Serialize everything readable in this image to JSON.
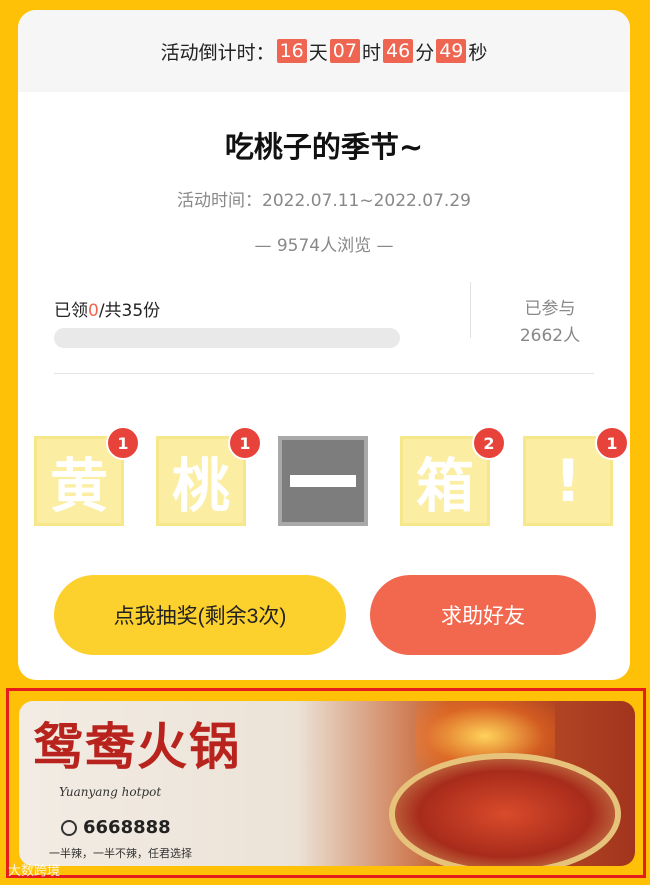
{
  "countdown": {
    "label": "活动倒计时：",
    "days": "16",
    "days_unit": "天",
    "hours": "07",
    "hours_unit": "时",
    "minutes": "46",
    "minutes_unit": "分",
    "seconds": "49",
    "seconds_unit": "秒"
  },
  "title": "吃桃子的季节~",
  "activity_time": "活动时间：2022.07.11~2022.07.29",
  "views": "— 9574人浏览 —",
  "stats": {
    "claimed_prefix": "已领",
    "claimed_count": "0",
    "claimed_suffix": "/共35份",
    "progress_fraction": 0,
    "joined_label": "已参与",
    "joined_count": "2662人"
  },
  "tiles": [
    {
      "char": "黄",
      "badge": "1"
    },
    {
      "char": "桃",
      "badge": "1"
    },
    {
      "char": "—",
      "badge": ""
    },
    {
      "char": "箱",
      "badge": "2"
    },
    {
      "char": "!",
      "badge": "1"
    }
  ],
  "buttons": {
    "draw_label": "点我抽奖(剩余3次)",
    "help_label": "求助好友"
  },
  "ad": {
    "name": "鸳鸯火锅",
    "subtitle": "Yuanyang hotpot",
    "phone": "6668888",
    "slogan": "一半辣，一半不辣，任君选择"
  },
  "watermark": "大数跨境",
  "colors": {
    "background": "#ffc107",
    "accent": "#ee6652",
    "draw_button": "#fcd02d",
    "help_button": "#f2684f",
    "badge": "#e8433b"
  }
}
